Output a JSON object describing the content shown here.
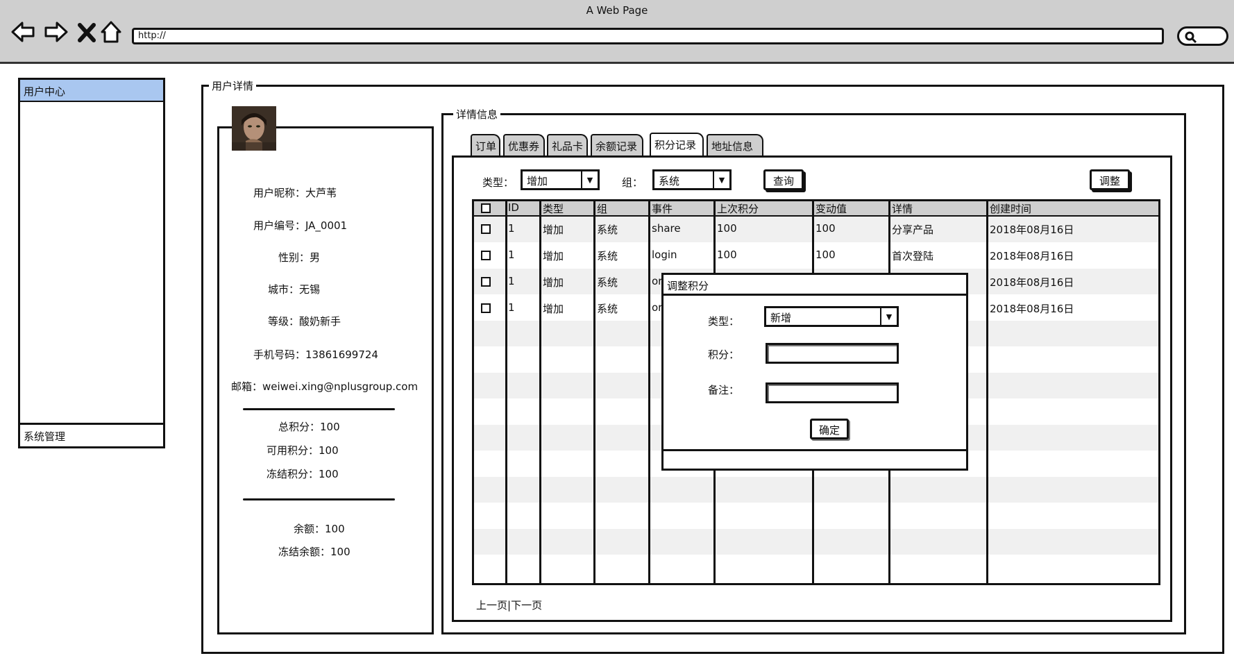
{
  "window": {
    "title": "A Web Page"
  },
  "browser": {
    "url": "http://",
    "nav_icons": [
      "back-arrow-icon",
      "forward-arrow-icon",
      "close-x-icon",
      "home-icon"
    ],
    "search_icon": "search-icon"
  },
  "sidebar": {
    "active_item": "用户中心",
    "bottom_item": "系统管理",
    "active_color": "#a9c7f0"
  },
  "user_detail": {
    "legend": "用户详情",
    "profile": {
      "nickname": "用户昵称：大芦苇",
      "user_id": "用户编号：JA_0001",
      "gender": "性别：男",
      "city": "城市：无锡",
      "level": "等级：酸奶新手",
      "phone": "手机号码：13861699724",
      "email": "邮箱：weiwei.xing@nplusgroup.com",
      "total_points": "总积分：100",
      "available_points": "可用积分：100",
      "frozen_points": "冻结积分：100",
      "balance": "余额：100",
      "frozen_balance": "冻结余额：100"
    }
  },
  "details": {
    "legend": "详情信息",
    "tabs": [
      "订单",
      "优惠券",
      "礼品卡",
      "余额记录",
      "积分记录",
      "地址信息"
    ],
    "active_tab": "积分记录",
    "filters": {
      "type_label": "类型：",
      "type_value": "增加",
      "group_label": "组：",
      "group_value": "系统",
      "query_button": "查询",
      "adjust_button": "调整"
    },
    "table": {
      "columns": [
        "ID",
        "类型",
        "组",
        "事件",
        "上次积分",
        "变动值",
        "详情",
        "创建时间"
      ],
      "rows": [
        {
          "id": "1",
          "type": "增加",
          "group": "系统",
          "event": "share",
          "prev": "100",
          "change": "100",
          "detail": "分享产品",
          "created": "2018年08月16日"
        },
        {
          "id": "1",
          "type": "增加",
          "group": "系统",
          "event": "login",
          "prev": "100",
          "change": "100",
          "detail": "首次登陆",
          "created": "2018年08月16日"
        },
        {
          "id": "1",
          "type": "增加",
          "group": "系统",
          "event": "or",
          "prev": "",
          "change": "",
          "detail": "",
          "created": "2018年08月16日"
        },
        {
          "id": "1",
          "type": "增加",
          "group": "系统",
          "event": "or",
          "prev": "",
          "change": "",
          "detail": "",
          "created": "2018年08月16日"
        }
      ]
    },
    "pager": {
      "prev": "上一页",
      "separator": "|",
      "next": "下一页"
    }
  },
  "modal": {
    "title": "调整积分",
    "type_label": "类型：",
    "type_value": "新增",
    "points_label": "积分：",
    "points_value": "",
    "note_label": "备注：",
    "note_value": "",
    "confirm_button": "确定"
  }
}
